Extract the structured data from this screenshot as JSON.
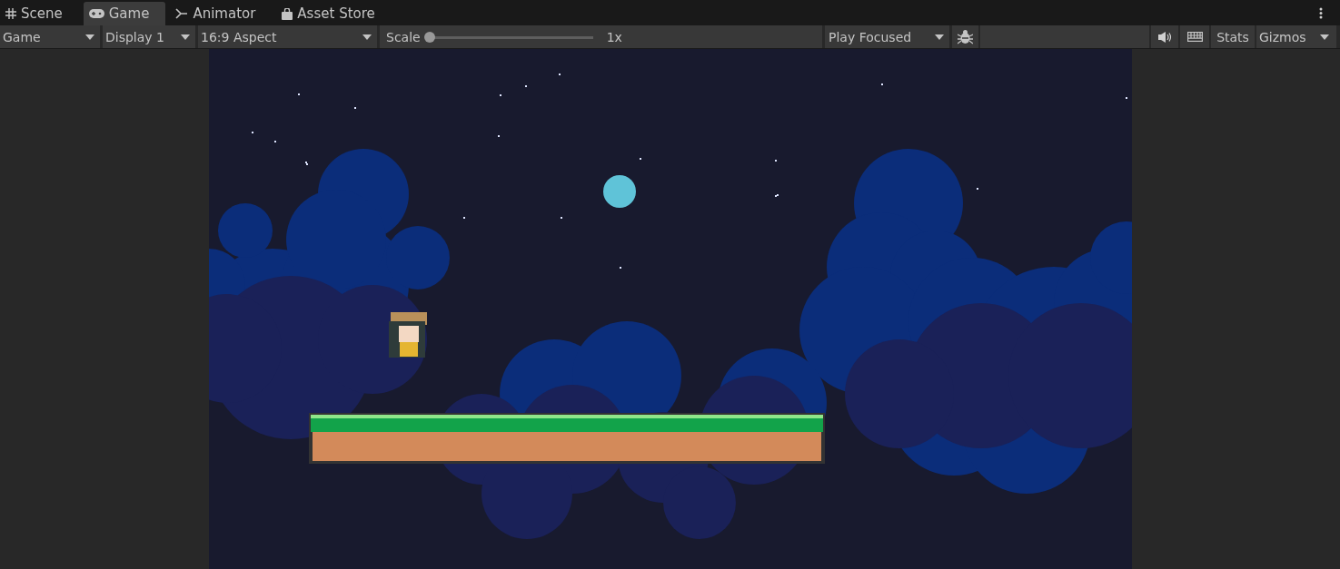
{
  "tabs": [
    {
      "label": "Scene",
      "selected": false
    },
    {
      "label": "Game",
      "selected": true
    },
    {
      "label": "Animator",
      "selected": false
    },
    {
      "label": "Asset Store",
      "selected": false
    }
  ],
  "toolbar": {
    "view_dropdown": "Game",
    "display_dropdown": "Display 1",
    "aspect_dropdown": "16:9 Aspect",
    "scale": {
      "label": "Scale",
      "level": 0,
      "reading": "1x"
    },
    "play_mode_dropdown": "Play Focused",
    "stats_button": "Stats",
    "gizmos_button": "Gizmos"
  }
}
